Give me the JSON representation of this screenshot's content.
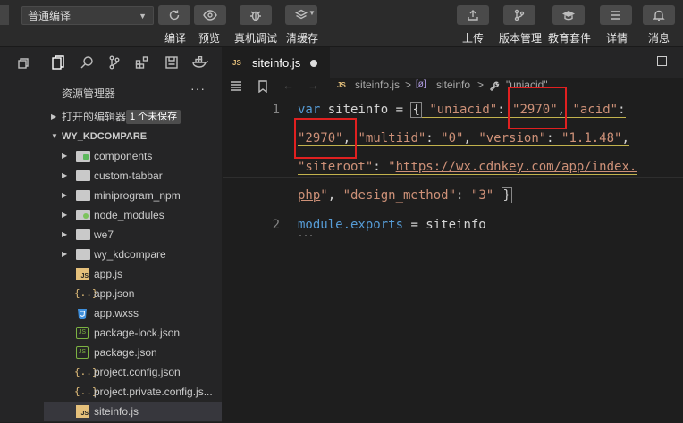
{
  "toolbar": {
    "mode_value": "普通编译",
    "compile_label": "编译",
    "preview_label": "预览",
    "debug_label": "真机调试",
    "clear_cache_label": "清缓存",
    "upload_label": "上传",
    "version_label": "版本管理",
    "edu_label": "教育套件",
    "details_label": "详情",
    "messages_label": "消息"
  },
  "explorer": {
    "title": "资源管理器",
    "more": "···",
    "open_editors_label": "打开的编辑器",
    "unsaved_badge": "1 个未保存",
    "project_label": "WY_KDCOMPARE",
    "items": [
      {
        "name": "components",
        "type": "folder"
      },
      {
        "name": "custom-tabbar",
        "type": "folder"
      },
      {
        "name": "miniprogram_npm",
        "type": "folder"
      },
      {
        "name": "node_modules",
        "type": "folder"
      },
      {
        "name": "we7",
        "type": "folder"
      },
      {
        "name": "wy_kdcompare",
        "type": "folder"
      },
      {
        "name": "app.js",
        "type": "js"
      },
      {
        "name": "app.json",
        "type": "json"
      },
      {
        "name": "app.wxss",
        "type": "wxss"
      },
      {
        "name": "package-lock.json",
        "type": "npm"
      },
      {
        "name": "package.json",
        "type": "npm"
      },
      {
        "name": "project.config.json",
        "type": "json"
      },
      {
        "name": "project.private.config.js...",
        "type": "json"
      },
      {
        "name": "siteinfo.js",
        "type": "js"
      }
    ]
  },
  "editor": {
    "tab_icon": "JS",
    "tab_name": "siteinfo.js",
    "breadcrumb": {
      "file": "siteinfo.js",
      "sep1": ">",
      "obj_icon": "[ø]",
      "obj": "siteinfo",
      "sep2": ">",
      "prop": "\"uniacid\""
    },
    "line_numbers": [
      "1",
      "2"
    ],
    "code": {
      "var": "var",
      "name": " siteinfo = ",
      "brace_open": "{",
      "k_uniacid": "\"uniacid\"",
      "v_uniacid": "\"2970\"",
      "k_acid": "\"acid\"",
      "v_acid": "\"2970\"",
      "k_multiid": "\"multiid\"",
      "v_multiid": "\"0\"",
      "k_version": "\"version\"",
      "v_version": "\"1.1.48\"",
      "k_siteroot": "\"siteroot\"",
      "v_siteroot_q": "\"",
      "v_siteroot_a": "https://wx.cdnkey.com/app/index.",
      "v_siteroot_b": "php",
      "k_design": "\"design_method\"",
      "v_design": "\"3\"",
      "brace_close": "}",
      "line2_module": "module",
      "line2_exports": ".exports",
      "line2_rest": " = siteinfo",
      "ellipsis": "···"
    }
  },
  "colors": {
    "keyword": "#569cd6",
    "string": "#ce9178",
    "highlight_box": "#e02020"
  }
}
